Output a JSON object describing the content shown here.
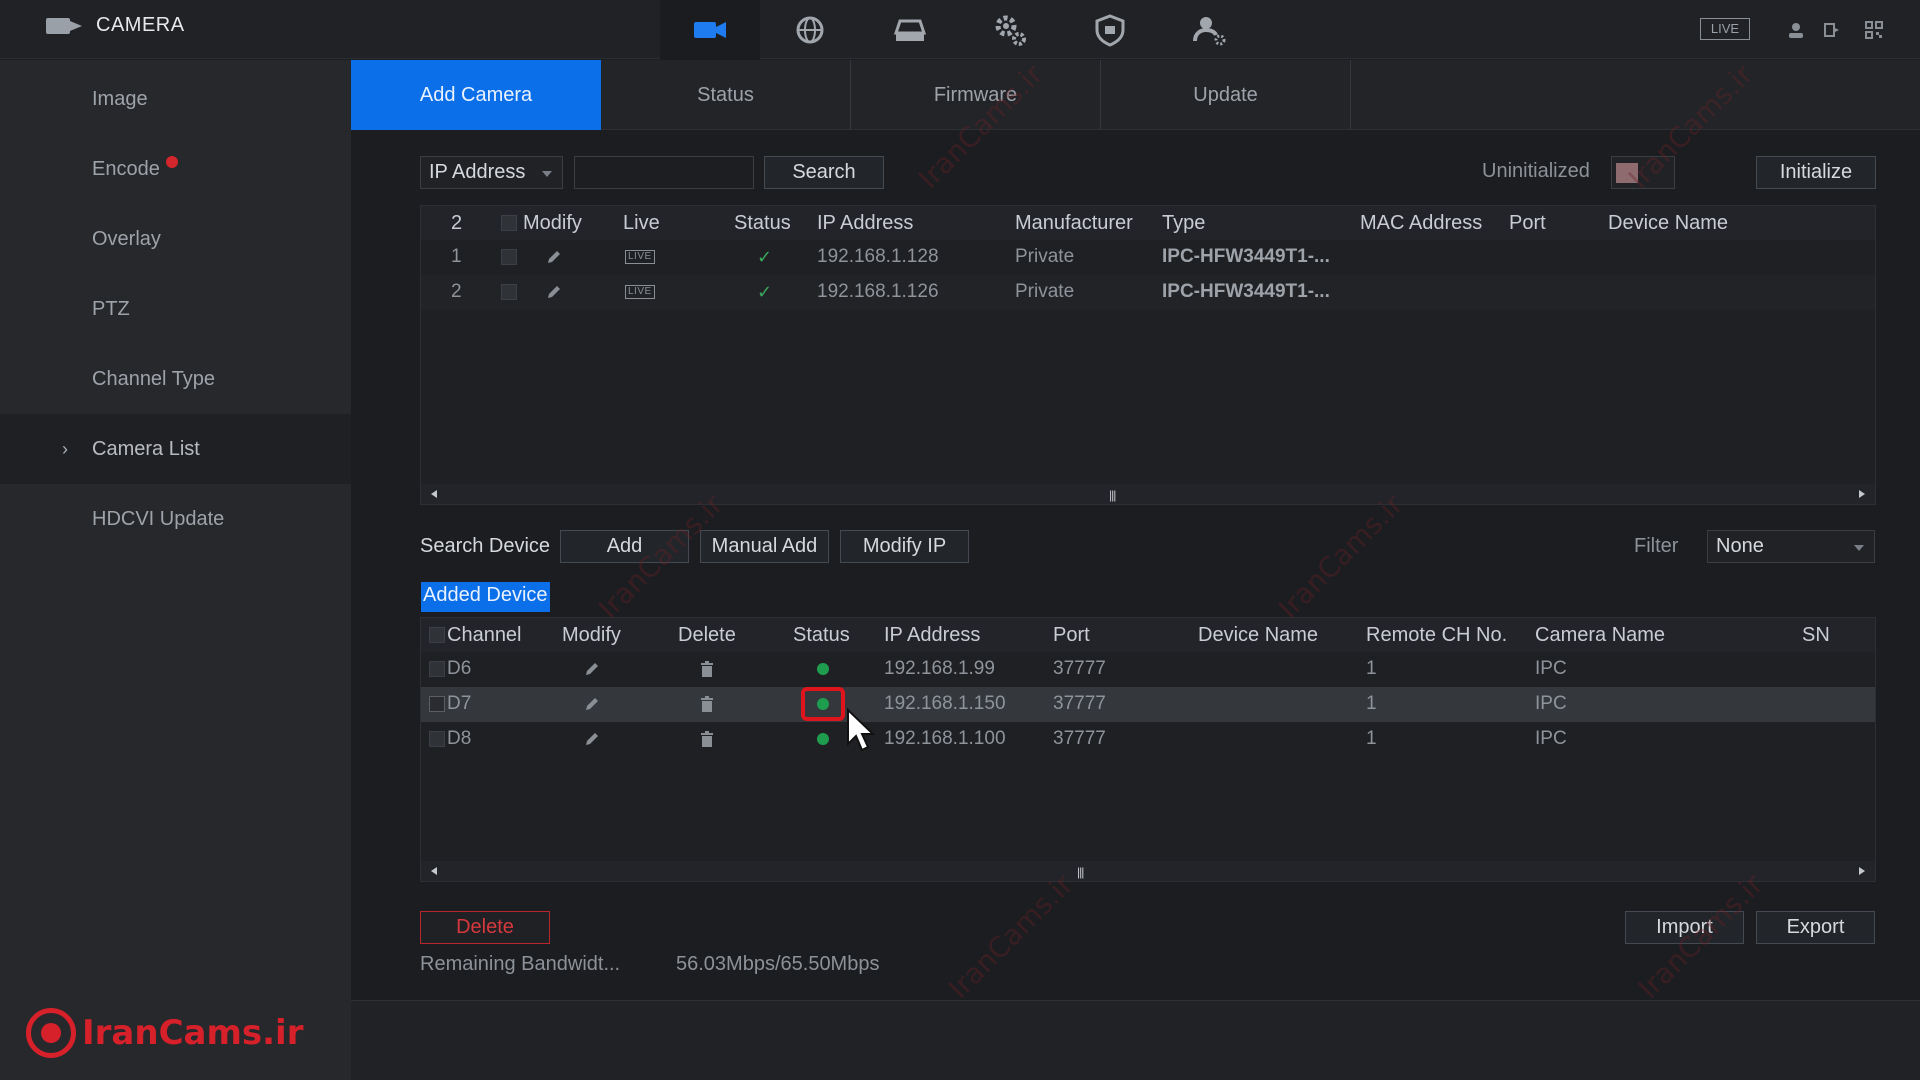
{
  "app": {
    "title": "CAMERA",
    "live_label": "LIVE"
  },
  "top_nav": [
    {
      "icon": "camera-icon"
    },
    {
      "icon": "network-globe-icon"
    },
    {
      "icon": "storage-icon"
    },
    {
      "icon": "settings-gears-icon"
    },
    {
      "icon": "shield-icon"
    },
    {
      "icon": "account-settings-icon"
    }
  ],
  "sidebar": {
    "items": [
      {
        "label": "Image"
      },
      {
        "label": "Encode"
      },
      {
        "label": "Overlay"
      },
      {
        "label": "PTZ"
      },
      {
        "label": "Channel Type"
      },
      {
        "label": "Camera List"
      },
      {
        "label": "HDCVI Update"
      }
    ],
    "active": "Camera List",
    "watermark": "IranCams.ir"
  },
  "tabs": [
    {
      "label": "Add Camera"
    },
    {
      "label": "Status"
    },
    {
      "label": "Firmware"
    },
    {
      "label": "Update"
    }
  ],
  "search_bar": {
    "filter_type": "IP Address",
    "query": "",
    "search_label": "Search",
    "uninitialized_label": "Uninitialized",
    "initialize_label": "Initialize"
  },
  "search_table": {
    "columns": {
      "count": "2",
      "modify": "Modify",
      "live": "Live",
      "status": "Status",
      "ip": "IP Address",
      "manufacturer": "Manufacturer",
      "type": "Type",
      "mac": "MAC Address",
      "port": "Port",
      "device_name": "Device Name"
    },
    "rows": [
      {
        "no": "1",
        "live": "LIVE",
        "ip": "192.168.1.128",
        "manufacturer": "Private",
        "type": "IPC-HFW3449T1-..."
      },
      {
        "no": "2",
        "live": "LIVE",
        "ip": "192.168.1.126",
        "manufacturer": "Private",
        "type": "IPC-HFW3449T1-..."
      }
    ]
  },
  "actions": {
    "search_device": "Search Device",
    "add": "Add",
    "manual_add": "Manual Add",
    "modify_ip": "Modify IP",
    "filter_label": "Filter",
    "filter_value": "None"
  },
  "added_device_label": "Added Device",
  "added_table": {
    "columns": {
      "channel": "Channel",
      "modify": "Modify",
      "delete": "Delete",
      "status": "Status",
      "ip": "IP Address",
      "port": "Port",
      "device_name": "Device Name",
      "remote_ch": "Remote CH No.",
      "camera_name": "Camera Name",
      "sn": "SN"
    },
    "rows": [
      {
        "channel": "D6",
        "ip": "192.168.1.99",
        "port": "37777",
        "remote_ch": "1",
        "camera_name": "IPC"
      },
      {
        "channel": "D7",
        "ip": "192.168.1.150",
        "port": "37777",
        "remote_ch": "1",
        "camera_name": "IPC"
      },
      {
        "channel": "D8",
        "ip": "192.168.1.100",
        "port": "37777",
        "remote_ch": "1",
        "camera_name": "IPC"
      }
    ]
  },
  "bottom": {
    "delete": "Delete",
    "import": "Import",
    "export": "Export",
    "bandwidth_label": "Remaining Bandwidt...",
    "bandwidth_value": "56.03Mbps/65.50Mbps"
  },
  "watermark_text": "IranCams.ir",
  "colors": {
    "accent": "#0a6fe8",
    "status_ok": "#1e9d4f",
    "highlight": "#e0141c",
    "brand": "#d6202a"
  }
}
